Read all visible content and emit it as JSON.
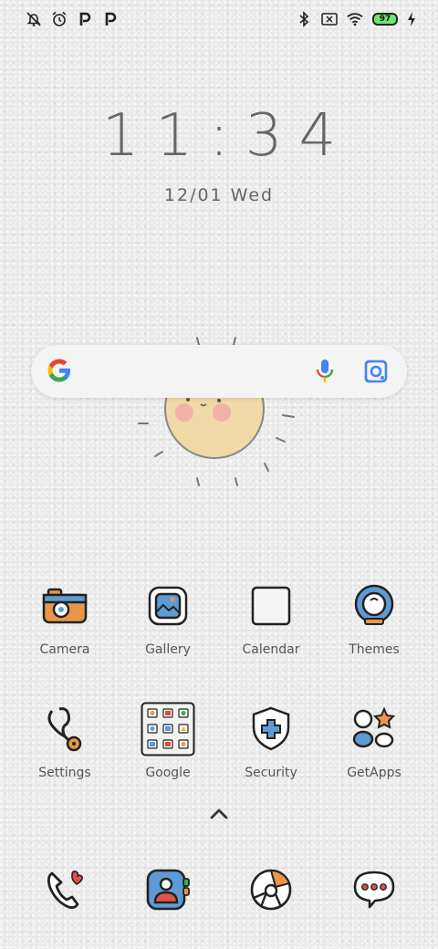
{
  "status_bar": {
    "left_icons": [
      "notifications-off-icon",
      "alarm-icon",
      "p-app-icon",
      "p-app-icon"
    ],
    "right_icons": [
      "bluetooth-icon",
      "no-sim-icon",
      "wifi-icon"
    ],
    "battery_level": "97",
    "charging": true
  },
  "clock": {
    "time": "11:34",
    "date": "12/01 Wed"
  },
  "search_bar": {
    "google_logo": "G"
  },
  "apps_row1": [
    {
      "label": "Camera"
    },
    {
      "label": "Gallery"
    },
    {
      "label": "Calendar"
    },
    {
      "label": "Themes"
    }
  ],
  "apps_row2": [
    {
      "label": "Settings"
    },
    {
      "label": "Google"
    },
    {
      "label": "Security"
    },
    {
      "label": "GetApps"
    }
  ],
  "dock": [
    "phone-icon",
    "contacts-icon",
    "browser-icon",
    "messages-icon"
  ],
  "colors": {
    "accent_orange": "#e9964a",
    "accent_blue": "#5e9bd4",
    "battery_green": "#6ee76e"
  }
}
